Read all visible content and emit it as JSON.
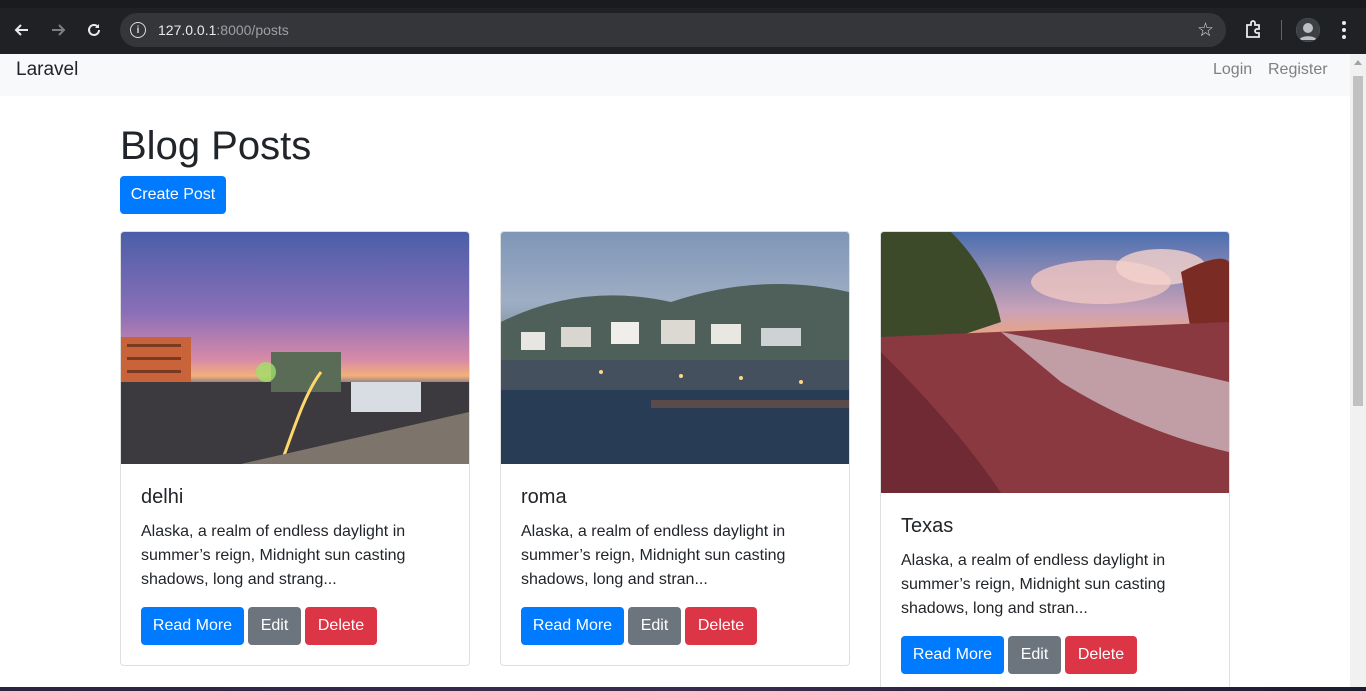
{
  "browser": {
    "url_host": "127.0.0.1",
    "url_path": ":8000/posts"
  },
  "navbar": {
    "brand": "Laravel",
    "login": "Login",
    "register": "Register"
  },
  "page": {
    "title": "Blog Posts",
    "create_button": "Create Post"
  },
  "posts": [
    {
      "title": "delhi",
      "excerpt": "Alaska, a realm of endless daylight in summer’s reign, Midnight sun casting shadows, long and strang...",
      "read_more": "Read More",
      "edit": "Edit",
      "delete": "Delete"
    },
    {
      "title": "roma",
      "excerpt": "Alaska, a realm of endless daylight in summer’s reign, Midnight sun casting shadows, long and stran...",
      "read_more": "Read More",
      "edit": "Edit",
      "delete": "Delete"
    },
    {
      "title": "Texas",
      "excerpt": "Alaska, a realm of endless daylight in summer’s reign, Midnight sun casting shadows, long and stran...",
      "read_more": "Read More",
      "edit": "Edit",
      "delete": "Delete"
    }
  ],
  "colors": {
    "primary": "#007bff",
    "secondary": "#6c757d",
    "danger": "#dc3545"
  }
}
